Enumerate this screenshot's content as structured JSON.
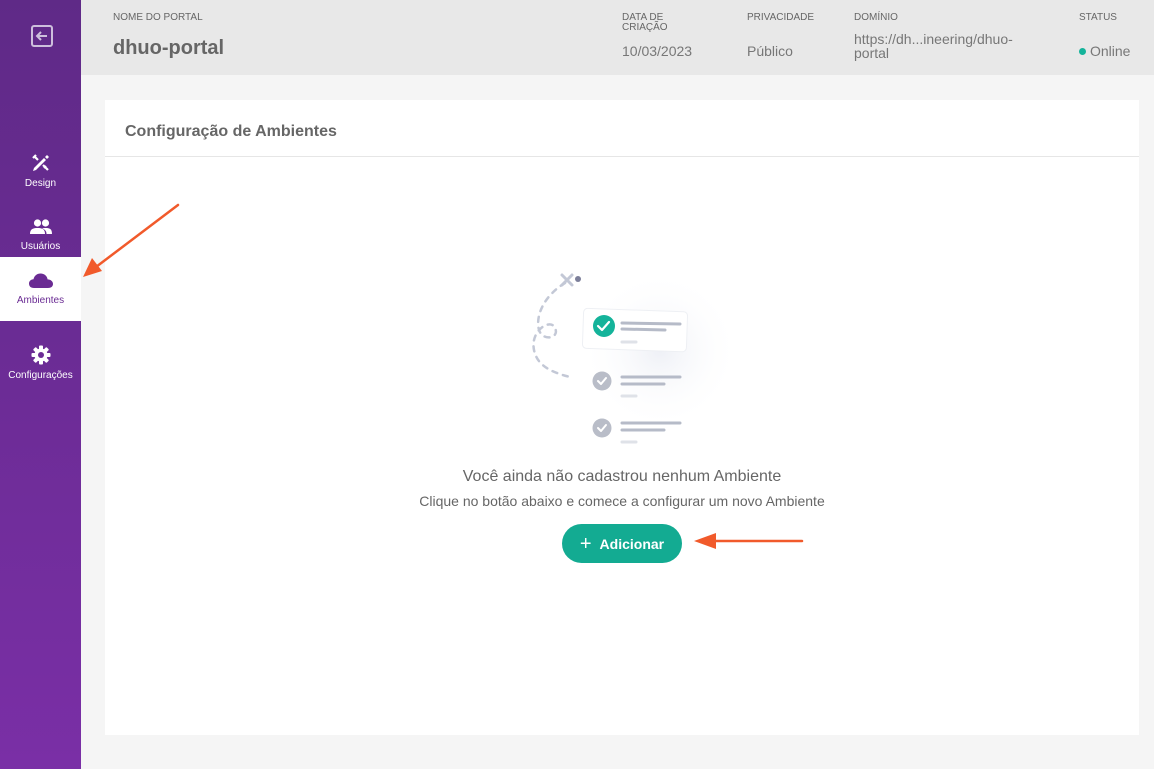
{
  "sidebar": {
    "items": [
      {
        "label": "Design",
        "icon": "design-tools-icon"
      },
      {
        "label": "Usuários",
        "icon": "users-icon"
      },
      {
        "label": "Ambientes",
        "icon": "cloud-icon",
        "active": true
      },
      {
        "label": "Configurações",
        "icon": "gear-icon"
      }
    ],
    "back_icon": "exit-icon"
  },
  "header": {
    "name_label": "NOME DO PORTAL",
    "name_value": "dhuo-portal",
    "date_label_1": "DATA DE",
    "date_label_2": "CRIAÇÃO",
    "date_value": "10/03/2023",
    "privacy_label": "PRIVACIDADE",
    "privacy_value": "Público",
    "domain_label": "DOMÍNIO",
    "domain_value_1": "https://dh...ineering/dhuo-",
    "domain_value_2": "portal",
    "status_label": "STATUS",
    "status_value": "Online",
    "status_color": "#14b39a"
  },
  "card": {
    "title": "Configuração de Ambientes",
    "empty_title": "Você ainda não cadastrou nenhum Ambiente",
    "empty_subtitle": "Clique no botão abaixo e comece a configurar um novo Ambiente",
    "add_label": "Adicionar",
    "add_icon": "plus-icon"
  },
  "colors": {
    "sidebar": "#6c2c96",
    "accent": "#13ab92",
    "annotation": "#f15a2b"
  }
}
